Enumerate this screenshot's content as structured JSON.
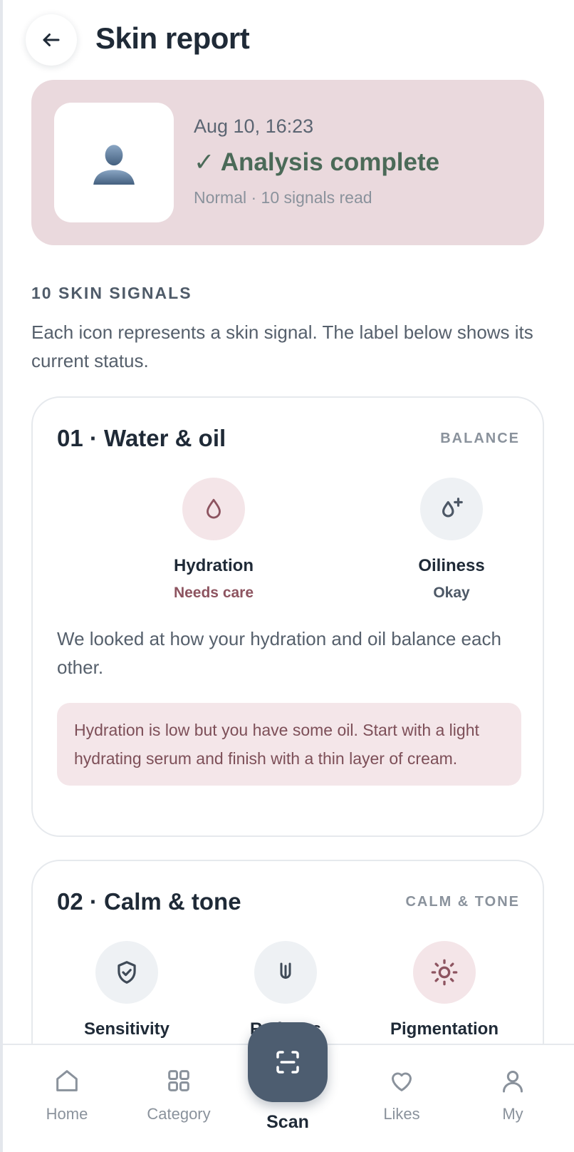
{
  "header": {
    "title": "Skin report"
  },
  "summary": {
    "date": "Aug 10, 16:23",
    "status": "✓ Analysis complete",
    "meta": "Normal · 10 signals read"
  },
  "section": {
    "label": "10 SKIN SIGNALS",
    "description": "Each icon represents a skin signal. The label below shows its current status."
  },
  "cards": [
    {
      "title": "01 · Water & oil",
      "tag": "BALANCE",
      "signals": [
        {
          "name": "Hydration",
          "status": "Needs care",
          "icon": "drop-icon",
          "level": "warn"
        },
        {
          "name": "Oiliness",
          "status": "Okay",
          "icon": "drop-plus-icon",
          "level": "ok"
        }
      ],
      "description": "We looked at how your hydration and oil balance each other.",
      "advice": "Hydration is low but you have some oil. Start with a light hydrating serum and finish with a thin layer of cream."
    },
    {
      "title": "02 · Calm & tone",
      "tag": "CALM & TONE",
      "signals": [
        {
          "name": "Sensitivity",
          "icon": "shield-check-icon",
          "level": "ok"
        },
        {
          "name": "Redness",
          "icon": "redness-icon",
          "level": "ok"
        },
        {
          "name": "Pigmentation",
          "icon": "sun-icon",
          "level": "warn"
        }
      ]
    }
  ],
  "nav": {
    "items": [
      {
        "label": "Home",
        "icon": "home-icon"
      },
      {
        "label": "Category",
        "icon": "grid-icon"
      },
      {
        "label": "Scan",
        "icon": "scan-icon"
      },
      {
        "label": "Likes",
        "icon": "heart-icon"
      },
      {
        "label": "My",
        "icon": "user-icon"
      }
    ]
  },
  "colors": {
    "accent": "#4d5d70",
    "summary_bg": "#ead9dd",
    "success": "#4b6a58",
    "warn": "#8d5460"
  }
}
